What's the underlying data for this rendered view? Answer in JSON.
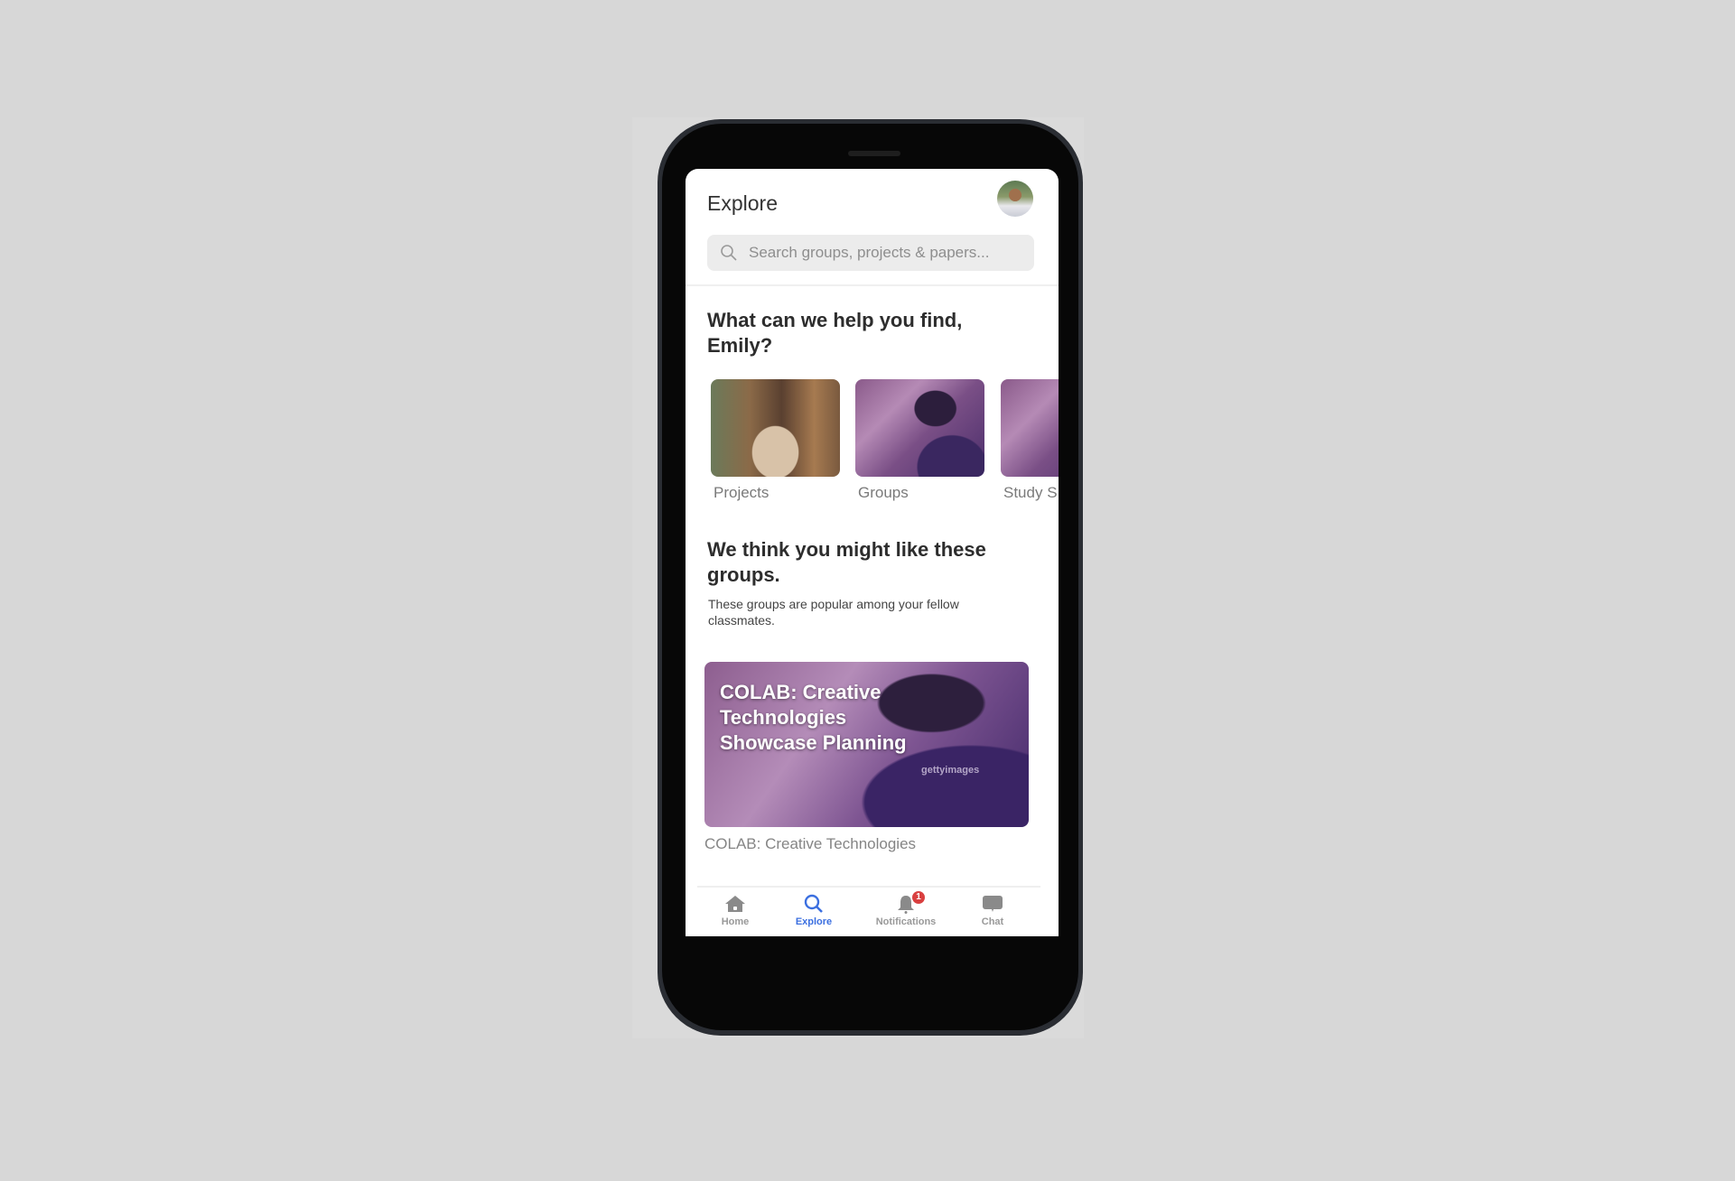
{
  "header": {
    "title": "Explore",
    "avatar_icon": "user-avatar",
    "search": {
      "placeholder": "Search groups, projects & papers...",
      "icon": "search-icon"
    }
  },
  "find_section": {
    "heading": "What can we help you find, Emily?",
    "categories": [
      {
        "label": "Projects"
      },
      {
        "label": "Groups"
      },
      {
        "label": "Study S"
      }
    ]
  },
  "groups_section": {
    "heading": "We think you might like these groups.",
    "subtitle": "These groups are popular among your fellow classmates.",
    "cards": [
      {
        "title": "COLAB: Creative Technologies Showcase Planning",
        "watermark": "gettyimages",
        "caption": "COLAB: Creative Technologies"
      }
    ]
  },
  "tabbar": {
    "items": [
      {
        "label": "Home",
        "icon": "home-icon",
        "active": false
      },
      {
        "label": "Explore",
        "icon": "search-icon",
        "active": true
      },
      {
        "label": "Notifications",
        "icon": "bell-icon",
        "active": false,
        "badge": "1"
      },
      {
        "label": "Chat",
        "icon": "chat-icon",
        "active": false
      }
    ],
    "active_color": "#3b6fe0",
    "inactive_color": "#999999",
    "badge_color": "#d94040"
  }
}
